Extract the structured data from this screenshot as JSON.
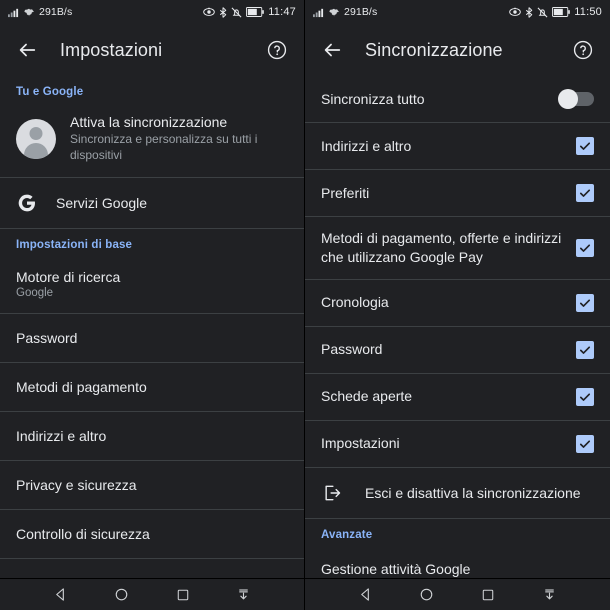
{
  "left": {
    "status": {
      "speed": "291B/s",
      "time": "11:47",
      "icons": [
        "signal-icon",
        "wifi-icon",
        "eye-icon",
        "bluetooth-icon",
        "notifications-off-icon",
        "battery-icon"
      ]
    },
    "appbar": {
      "back": "back-arrow-icon",
      "title": "Impostazioni",
      "help": "help-icon"
    },
    "sections": {
      "you_and_google": "Tu e Google",
      "basics": "Impostazioni di base"
    },
    "account": {
      "title": "Attiva la sincronizzazione",
      "subtitle": "Sincronizza e personalizza su tutti i dispositivi"
    },
    "google_services": {
      "label": "Servizi Google",
      "icon": "google-g-icon"
    },
    "items": [
      {
        "title": "Motore di ricerca",
        "subtitle": "Google"
      },
      {
        "title": "Password",
        "subtitle": ""
      },
      {
        "title": "Metodi di pagamento",
        "subtitle": ""
      },
      {
        "title": "Indirizzi e altro",
        "subtitle": ""
      },
      {
        "title": "Privacy e sicurezza",
        "subtitle": ""
      },
      {
        "title": "Controllo di sicurezza",
        "subtitle": ""
      }
    ]
  },
  "right": {
    "status": {
      "speed": "291B/s",
      "time": "11:50",
      "icons": [
        "signal-icon",
        "wifi-icon",
        "eye-icon",
        "bluetooth-icon",
        "notifications-off-icon",
        "battery-icon"
      ]
    },
    "appbar": {
      "back": "back-arrow-icon",
      "title": "Sincronizzazione",
      "help": "help-icon"
    },
    "sync_all": {
      "label": "Sincronizza tutto",
      "state": "off"
    },
    "items": [
      {
        "label": "Indirizzi e altro",
        "checked": true
      },
      {
        "label": "Preferiti",
        "checked": true
      },
      {
        "label": "Metodi di pagamento, offerte e indirizzi che utilizzano Google Pay",
        "checked": true
      },
      {
        "label": "Cronologia",
        "checked": true
      },
      {
        "label": "Password",
        "checked": true
      },
      {
        "label": "Schede aperte",
        "checked": true
      },
      {
        "label": "Impostazioni",
        "checked": true
      }
    ],
    "signout": {
      "label": "Esci e disattiva la sincronizzazione",
      "icon": "logout-icon"
    },
    "advanced_header": "Avanzate",
    "advanced_items": [
      {
        "label": "Gestione attività Google"
      }
    ]
  },
  "navbar": {
    "back": "nav-back-icon",
    "home": "nav-home-icon",
    "recents": "nav-recents-icon",
    "hide": "nav-hide-keyboard-icon"
  },
  "colors": {
    "background": "#202124",
    "accent": "#8ab4f8",
    "checkbox": "#aecbfa",
    "text_primary": "#e8eaed",
    "text_secondary": "#9aa0a6",
    "divider": "#3c4043"
  }
}
